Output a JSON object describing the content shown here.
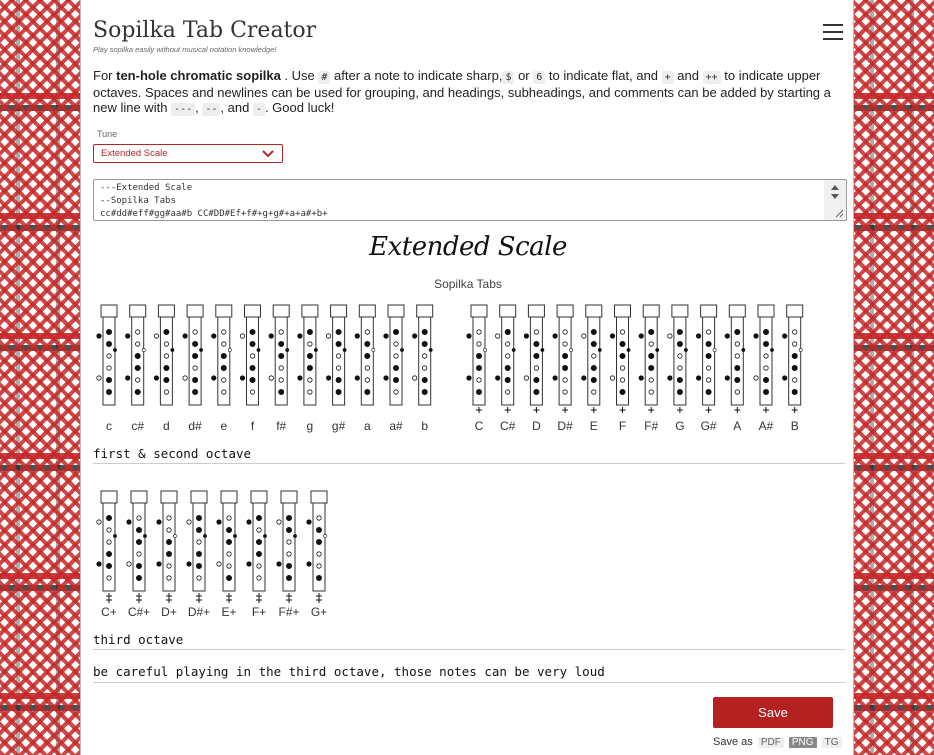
{
  "app": {
    "title": "Sopilka Tab Creator",
    "subtitle": "Play sopilka easily without musical notation knowledge!"
  },
  "intro": {
    "p1": "For ",
    "bold": "ten-hole chromatic sopilka",
    "p2": " . Use ",
    "c1": "#",
    "p3": " after a note to indicate sharp,",
    "c2": "$",
    "p4": " or ",
    "c3": "6",
    "p5": " to indicate flat, and ",
    "c4": "+",
    "p6": " and ",
    "c5": "++",
    "p7": " to indicate upper octaves. Spaces and newlines can be used for grouping, and headings, subheadings, and comments can be added by starting a new line with ",
    "c6": "---",
    "p8": ", ",
    "c7": "--",
    "p9": ", and ",
    "c8": "-",
    "p10": ". Good luck!"
  },
  "tune": {
    "label": "Tune",
    "selected": "Extended Scale"
  },
  "textarea": {
    "lines": [
      "---Extended Scale",
      "--Sopilka Tabs",
      "cc#dd#eff#gg#aa#b CC#DD#Ef+f#+g+g#+a+a#+b+"
    ]
  },
  "score": {
    "title": "Extended Scale",
    "subtitle": "Sopilka Tabs",
    "row1_left": [
      "c",
      "c#",
      "d",
      "d#",
      "e",
      "f",
      "f#",
      "g",
      "g#",
      "a",
      "a#",
      "b"
    ],
    "row1_right": [
      "C",
      "C#",
      "D",
      "D#",
      "E",
      "F",
      "F#",
      "G",
      "G#",
      "A",
      "A#",
      "B"
    ],
    "section1": "first & second octave",
    "row2": [
      "C+",
      "C#+",
      "D+",
      "D#+",
      "E+",
      "F+",
      "F#+",
      "G+"
    ],
    "section2": "third octave",
    "comment": "be careful playing in the third octave, those notes can be very loud"
  },
  "save": {
    "label": "Save",
    "save_as": "Save as",
    "formats": [
      "PDF",
      "PNG",
      "TG"
    ],
    "active_format": "PNG"
  },
  "colors": {
    "accent": "#b32121",
    "border_red": "#c62828"
  }
}
